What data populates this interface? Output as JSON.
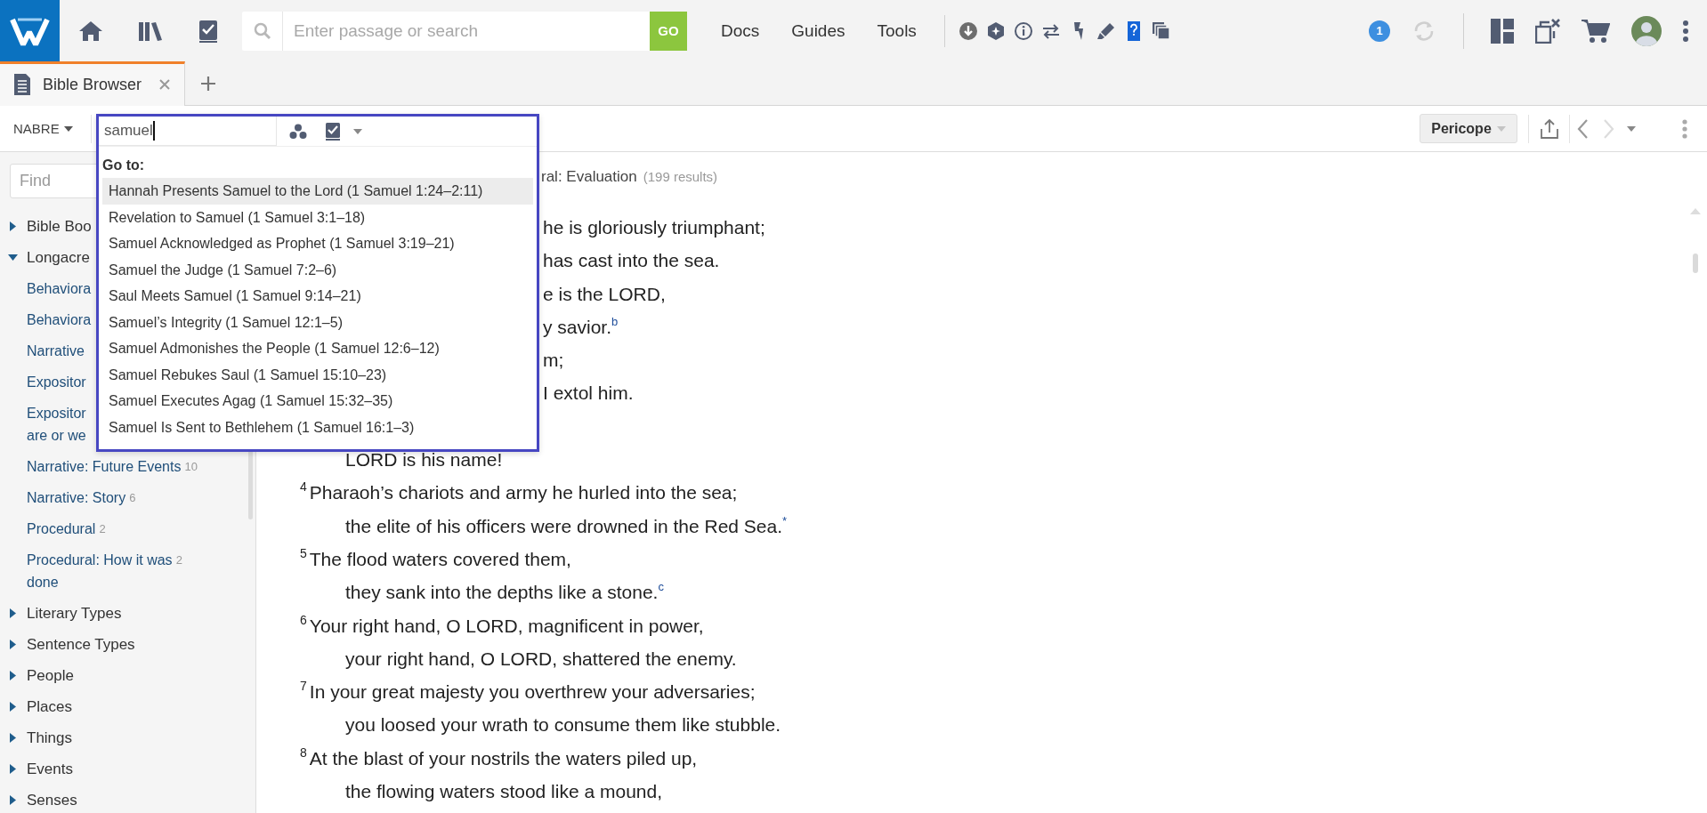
{
  "app_bar": {
    "search": {
      "placeholder": "Enter passage or search",
      "button": "GO"
    },
    "menu": [
      "Docs",
      "Guides",
      "Tools"
    ],
    "notifications": "1"
  },
  "tabs": [
    {
      "label": "Bible Browser",
      "selected": true
    }
  ],
  "toolbar": {
    "version": "NABRE",
    "view_button": "Pericope",
    "back": {
      "disabled": false
    },
    "forward": {
      "disabled": true
    }
  },
  "sidebar": {
    "find_placeholder": "Find",
    "tree": [
      {
        "label": "Bible Boo",
        "expanded": false
      },
      {
        "label": "Longacre",
        "expanded": true,
        "children": [
          {
            "label": "Behaviora"
          },
          {
            "label": "Behaviora"
          },
          {
            "label": "Narrative"
          },
          {
            "label": "Expositor"
          },
          {
            "label": "Expositor\nare or we"
          },
          {
            "label": "Narrative: Future Events",
            "count": "10"
          },
          {
            "label": "Narrative: Story",
            "count": "6"
          },
          {
            "label": "Procedural",
            "count": "2"
          },
          {
            "label": "Procedural: How it was\ndone",
            "count": "2"
          }
        ]
      },
      {
        "label": "Literary Types",
        "expanded": false
      },
      {
        "label": "Sentence Types",
        "expanded": false
      },
      {
        "label": "People",
        "expanded": false
      },
      {
        "label": "Places",
        "expanded": false
      },
      {
        "label": "Things",
        "expanded": false
      },
      {
        "label": "Events",
        "expanded": false
      },
      {
        "label": "Senses",
        "expanded": false
      }
    ]
  },
  "main": {
    "heading": "ral: Evaluation",
    "result_count": "(199 results)",
    "covered_lines": [
      "he is gloriously triumphant;",
      "has cast into the sea.",
      "e is the LORD,",
      "y savior.$^{b}$",
      "m;",
      "I extol him."
    ],
    "lines": [
      {
        "kind": "continuation",
        "text": "LORD is his name!"
      },
      {
        "kind": "verse",
        "verse": "4",
        "text": "Pharaoh’s chariots and army he hurled into the sea;"
      },
      {
        "kind": "continuation",
        "text": "the elite of his officers were drowned in the Red Sea.$^{*}$"
      },
      {
        "kind": "verse",
        "verse": "5",
        "text": "The flood waters covered them,"
      },
      {
        "kind": "continuation",
        "text": "they sank into the depths like a stone.$^{c}$"
      },
      {
        "kind": "verse",
        "verse": "6",
        "text": "Your right hand, O LORD, magnificent in power,"
      },
      {
        "kind": "continuation",
        "text": "your right hand, O LORD, shattered the enemy."
      },
      {
        "kind": "verse",
        "verse": "7",
        "text": "In your great majesty you overthrew your adversaries;"
      },
      {
        "kind": "continuation",
        "text": "you loosed your wrath to consume them like stubble."
      },
      {
        "kind": "verse",
        "verse": "8",
        "text": "At the blast of your nostrils the waters piled up,"
      },
      {
        "kind": "continuation",
        "text": "the flowing waters stood like a mound,"
      }
    ]
  },
  "dropdown": {
    "query": "samuel",
    "heading": "Go to:",
    "items": [
      {
        "label": "Hannah Presents Samuel to the Lord (1 Samuel 1:24–2:11)",
        "selected": true
      },
      {
        "label": "Revelation to Samuel (1 Samuel 3:1–18)",
        "selected": false
      },
      {
        "label": "Samuel Acknowledged as Prophet (1 Samuel 3:19–21)",
        "selected": false
      },
      {
        "label": "Samuel the Judge (1 Samuel 7:2–6)",
        "selected": false
      },
      {
        "label": "Saul Meets Samuel (1 Samuel 9:14–21)",
        "selected": false
      },
      {
        "label": "Samuel’s Integrity (1 Samuel 12:1–5)",
        "selected": false
      },
      {
        "label": "Samuel Admonishes the People (1 Samuel 12:6–12)",
        "selected": false
      },
      {
        "label": "Samuel Rebukes Saul (1 Samuel 15:10–23)",
        "selected": false
      },
      {
        "label": "Samuel Executes Agag (1 Samuel 15:32–35)",
        "selected": false
      },
      {
        "label": "Samuel Is Sent to Bethlehem (1 Samuel 16:1–3)",
        "selected": false
      }
    ]
  }
}
